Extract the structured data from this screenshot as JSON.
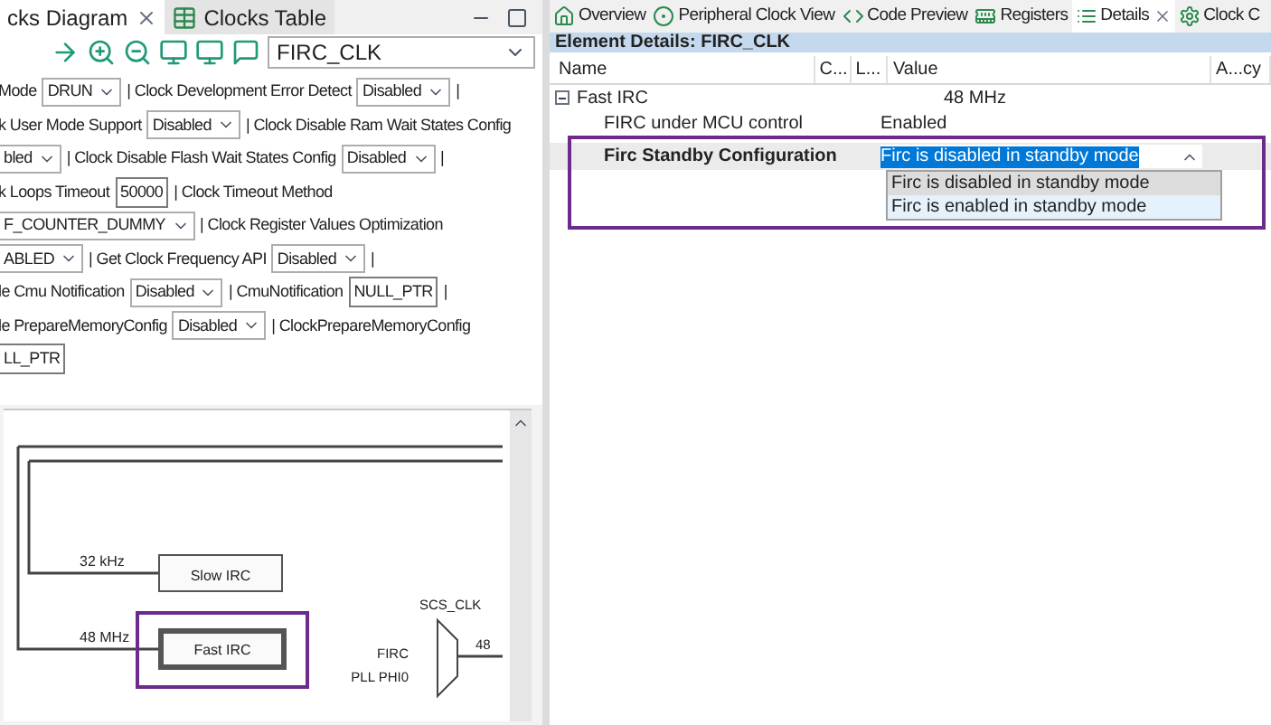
{
  "left_tabs": [
    {
      "label": "cks Diagram",
      "selected": true
    },
    {
      "label": "Clocks Table",
      "selected": false
    }
  ],
  "toolbar": {
    "clock_select": {
      "value": "FIRC_CLK"
    }
  },
  "config_lines": [
    [
      {
        "kind": "label",
        "text": "Mode"
      },
      {
        "kind": "select",
        "text": "DRUN"
      },
      {
        "kind": "label",
        "text": "| Clock Development Error Detect"
      },
      {
        "kind": "select",
        "text": "Disabled"
      },
      {
        "kind": "label",
        "text": "|"
      }
    ],
    [
      {
        "kind": "label",
        "text": "k User Mode Support"
      },
      {
        "kind": "select",
        "text": "Disabled"
      },
      {
        "kind": "label",
        "text": "| Clock Disable Ram Wait States Config"
      }
    ],
    [
      {
        "kind": "select",
        "text": "bled"
      },
      {
        "kind": "label",
        "text": "| Clock Disable Flash Wait States Config"
      },
      {
        "kind": "select",
        "text": "Disabled"
      },
      {
        "kind": "label",
        "text": "|"
      }
    ],
    [
      {
        "kind": "label",
        "text": "k Loops Timeout"
      },
      {
        "kind": "input",
        "text": "50000"
      },
      {
        "kind": "label",
        "text": "| Clock Timeout Method"
      }
    ],
    [
      {
        "kind": "select",
        "text": "F_COUNTER_DUMMY"
      },
      {
        "kind": "label",
        "text": "| Clock Register Values Optimization"
      }
    ],
    [
      {
        "kind": "select",
        "text": "ABLED"
      },
      {
        "kind": "label",
        "text": "| Get Clock Frequency API"
      },
      {
        "kind": "select",
        "text": "Disabled"
      },
      {
        "kind": "label",
        "text": "|"
      }
    ],
    [
      {
        "kind": "label",
        "text": "le Cmu Notification"
      },
      {
        "kind": "select",
        "text": "Disabled"
      },
      {
        "kind": "label",
        "text": "| CmuNotification"
      },
      {
        "kind": "input",
        "text": "NULL_PTR"
      },
      {
        "kind": "label",
        "text": "|"
      }
    ],
    [
      {
        "kind": "label",
        "text": "le PrepareMemoryConfig"
      },
      {
        "kind": "select",
        "text": "Disabled"
      },
      {
        "kind": "label",
        "text": "| ClockPrepareMemoryConfig"
      }
    ],
    [
      {
        "kind": "input",
        "text": "LL_PTR"
      }
    ]
  ],
  "diagram": {
    "slow_label": "32 kHz",
    "slow_block": "Slow IRC",
    "fast_label": "48 MHz",
    "fast_block": "Fast IRC",
    "fast_highlighted": true,
    "mux_title": "SCS_CLK",
    "mux_inputs": [
      "FIRC",
      "PLL PHI0"
    ],
    "mux_output": "48"
  },
  "right_tabs": [
    {
      "label": "Overview",
      "selected": false
    },
    {
      "label": "Peripheral Clock View",
      "selected": false
    },
    {
      "label": "Code Preview",
      "selected": false
    },
    {
      "label": "Registers",
      "selected": false
    },
    {
      "label": "Details",
      "selected": true
    },
    {
      "label": "Clock C",
      "selected": false
    }
  ],
  "details": {
    "title": "Element Details: FIRC_CLK",
    "columns": [
      "Name",
      "C...",
      "L...",
      "Value",
      "A...cy"
    ],
    "tree": {
      "name": "Fast IRC",
      "value": "48 MHz",
      "expanded": true,
      "children": [
        {
          "name": "FIRC under MCU control",
          "value": "Enabled",
          "selected": false
        },
        {
          "name": "Firc Standby Configuration",
          "value": "Firc is disabled in standby mode",
          "selected": true
        }
      ]
    },
    "dropdown": {
      "options": [
        {
          "label": "Firc is disabled in standby mode",
          "selected": true
        },
        {
          "label": "Firc is enabled in standby mode",
          "selected": false
        }
      ]
    }
  }
}
